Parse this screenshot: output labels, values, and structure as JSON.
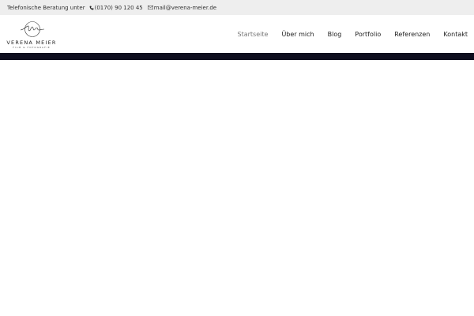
{
  "topbar": {
    "intro": "Telefonische Beratung unter",
    "phone": "(0170) 90 120 45",
    "email": "mail@verena-meier.de",
    "icons": {
      "phone": "phone-icon",
      "email": "mail-icon"
    }
  },
  "logo": {
    "name": "VERENA MEIER",
    "tagline": "FILM & FOTOGRAFIE"
  },
  "nav": {
    "items": [
      {
        "label": "Startseite",
        "active": true
      },
      {
        "label": "Über mich",
        "active": false
      },
      {
        "label": "Blog",
        "active": false
      },
      {
        "label": "Portfolio",
        "active": false
      },
      {
        "label": "Referenzen",
        "active": false
      },
      {
        "label": "Kontakt",
        "active": false
      }
    ]
  },
  "colors": {
    "topbar_bg": "#eeeeee",
    "band": "#0e0e1e",
    "nav_active": "#777777",
    "text": "#222222"
  }
}
